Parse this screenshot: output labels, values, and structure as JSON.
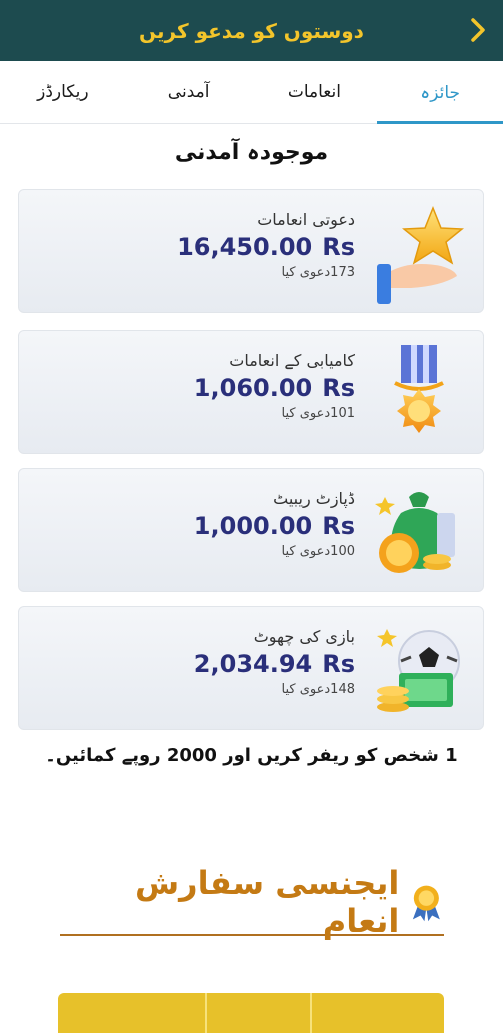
{
  "header": {
    "title": "دوستوں کو مدعو کریں",
    "back_icon": "chevron-right-icon"
  },
  "tabs": [
    {
      "label": "جائزہ",
      "active": true
    },
    {
      "label": "انعامات",
      "active": false
    },
    {
      "label": "آمدنی",
      "active": false
    },
    {
      "label": "ریکارڈز",
      "active": false
    }
  ],
  "section_title": "موجودہ آمدنی",
  "cards": [
    {
      "label": "دعوتی انعامات",
      "amount": "16,450.00",
      "currency": "Rs",
      "claims": "173دعوی کیا",
      "icon": "hand-star-icon"
    },
    {
      "label": "کامیابی کے انعامات",
      "amount": "1,060.00",
      "currency": "Rs",
      "claims": "101دعوی کیا",
      "icon": "medal-icon"
    },
    {
      "label": "ڈپازٹ ریبیٹ",
      "amount": "1,000.00",
      "currency": "Rs",
      "claims": "100دعوی کیا",
      "icon": "money-bag-icon"
    },
    {
      "label": "بازی کی چھوٹ",
      "amount": "2,034.94",
      "currency": "Rs",
      "claims": "148دعوی کیا",
      "icon": "football-cash-icon"
    }
  ],
  "refer_text": "1 شخص کو ریفر کریں اور 2000 روپے کمائیں۔",
  "agency": {
    "title": "ایجنسی سفارش انعام",
    "icon": "award-ribbon-icon"
  },
  "colors": {
    "header_bg": "#1d4b4f",
    "header_text": "#f3c52b",
    "tab_active": "#2f97c8",
    "amount": "#2a2f7a",
    "agency_title": "#c47a14"
  }
}
